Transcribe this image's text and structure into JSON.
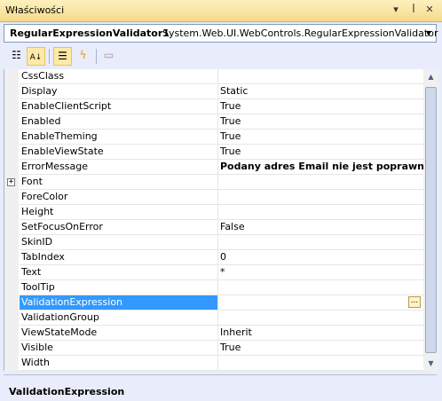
{
  "window": {
    "title": "Właściwości",
    "pin_icon": "pin-icon",
    "close_icon": "close-icon",
    "menu_icon": "dropdown-icon"
  },
  "selector": {
    "object_name": "RegularExpressionValidator1",
    "object_type": "System.Web.UI.WebControls.RegularExpressionValidator"
  },
  "toolbar": {
    "buttons": [
      {
        "icon": "categorized-icon",
        "active": false
      },
      {
        "icon": "alphabetical-icon",
        "active": true
      },
      {
        "icon": "properties-icon",
        "active": true
      },
      {
        "icon": "events-icon",
        "active": false
      },
      {
        "icon": "property-pages-icon",
        "active": false
      }
    ]
  },
  "properties": [
    {
      "name": "CssClass",
      "value": ""
    },
    {
      "name": "Display",
      "value": "Static"
    },
    {
      "name": "EnableClientScript",
      "value": "True"
    },
    {
      "name": "Enabled",
      "value": "True"
    },
    {
      "name": "EnableTheming",
      "value": "True"
    },
    {
      "name": "EnableViewState",
      "value": "True"
    },
    {
      "name": "ErrorMessage",
      "value": "Podany adres Email nie jest poprawny!!!"
    },
    {
      "name": "Font",
      "value": ""
    },
    {
      "name": "ForeColor",
      "value": ""
    },
    {
      "name": "Height",
      "value": ""
    },
    {
      "name": "SetFocusOnError",
      "value": "False"
    },
    {
      "name": "SkinID",
      "value": ""
    },
    {
      "name": "TabIndex",
      "value": "0"
    },
    {
      "name": "Text",
      "value": "*"
    },
    {
      "name": "ToolTip",
      "value": ""
    },
    {
      "name": "ValidationExpression",
      "value": ""
    },
    {
      "name": "ValidationGroup",
      "value": ""
    },
    {
      "name": "ViewStateMode",
      "value": "Inherit"
    },
    {
      "name": "Visible",
      "value": "True"
    },
    {
      "name": "Width",
      "value": ""
    }
  ],
  "description": {
    "title": "ValidationExpression"
  },
  "colors": {
    "selection": "#3399ff",
    "titlebar": "#f6da8a",
    "background": "#e9ecfa"
  }
}
